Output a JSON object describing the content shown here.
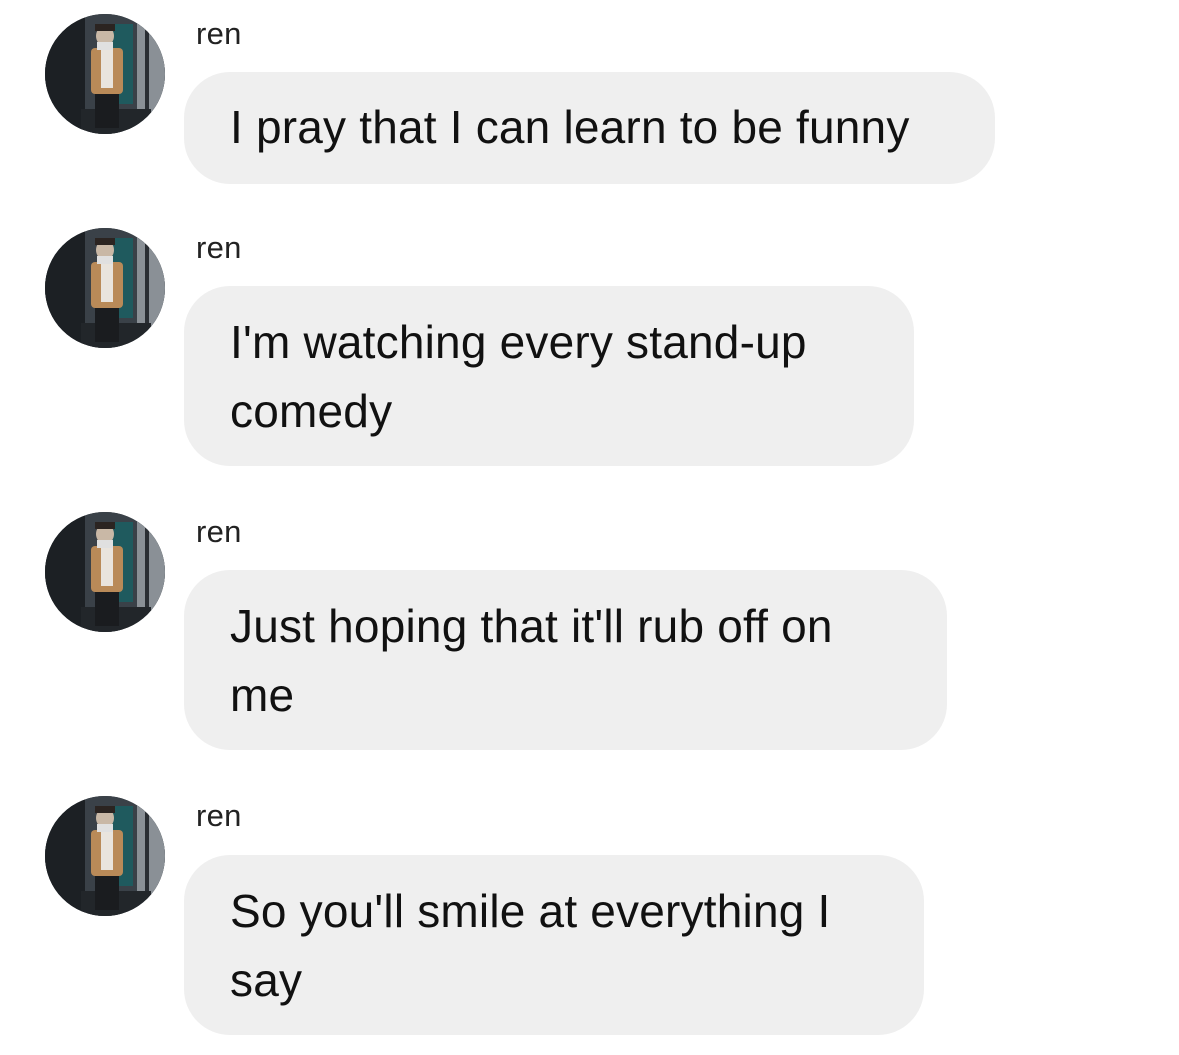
{
  "conversation": {
    "messages": [
      {
        "sender": "ren",
        "avatar_icon": "profile-photo-icon",
        "text": "I pray that I can learn to be funny"
      },
      {
        "sender": "ren",
        "avatar_icon": "profile-photo-icon",
        "text": "I'm watching every stand-up comedy"
      },
      {
        "sender": "ren",
        "avatar_icon": "profile-photo-icon",
        "text": "Just hoping that it'll rub off on me"
      },
      {
        "sender": "ren",
        "avatar_icon": "profile-photo-icon",
        "text": "So you'll smile at everything I say"
      }
    ]
  },
  "colors": {
    "background": "#ffffff",
    "bubble": "#efefef",
    "text": "#111111"
  }
}
